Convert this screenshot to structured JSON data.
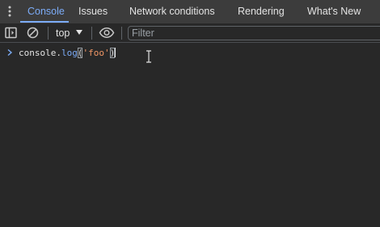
{
  "tabs": [
    {
      "label": "Console",
      "active": true
    },
    {
      "label": "Issues",
      "active": false
    },
    {
      "label": "Network conditions",
      "active": false
    },
    {
      "label": "Rendering",
      "active": false
    },
    {
      "label": "What's New",
      "active": false
    }
  ],
  "toolbar": {
    "context_label": "top",
    "filter_placeholder": "Filter"
  },
  "console": {
    "input": {
      "object": "console",
      "dot": ".",
      "method": "log",
      "open_paren": "(",
      "string": "'foo'",
      "close_paren": ")"
    }
  },
  "icons": {
    "more": "more-vertical-icon",
    "sidebar": "show-sidebar-icon",
    "clear": "clear-console-icon",
    "dropdown": "dropdown-triangle-icon",
    "live_expression": "eye-icon",
    "prompt": "prompt-chevron-icon",
    "cursor": "text-cursor-icon"
  },
  "colors": {
    "background": "#282828",
    "tabbar": "#3c3c3c",
    "accent": "#7cacf8",
    "string": "#f29766"
  }
}
